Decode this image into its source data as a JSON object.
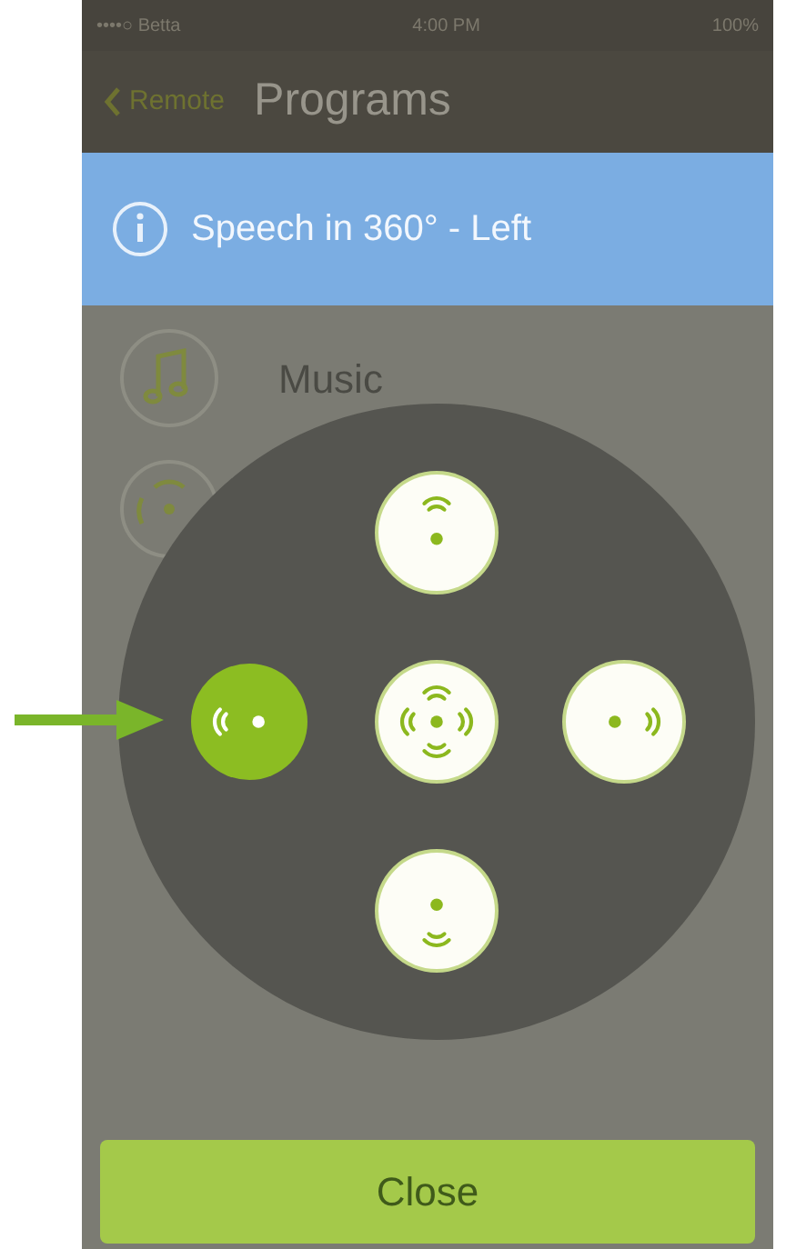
{
  "status_bar": {
    "carrier": "••••○ Betta",
    "time": "4:00 PM",
    "battery": "100%"
  },
  "nav_bar": {
    "back": "Remote",
    "title": "Programs"
  },
  "banner": {
    "text": "Speech in 360° - Left"
  },
  "programs": [
    {
      "kind": "music",
      "label": "Music"
    },
    {
      "kind": "speech"
    }
  ],
  "directions": [
    {
      "kind": "top",
      "selected": false
    },
    {
      "kind": "left",
      "selected": true
    },
    {
      "kind": "center",
      "selected": false
    },
    {
      "kind": "right",
      "selected": false
    },
    {
      "kind": "bottom",
      "selected": false
    }
  ],
  "close_button": "Close"
}
